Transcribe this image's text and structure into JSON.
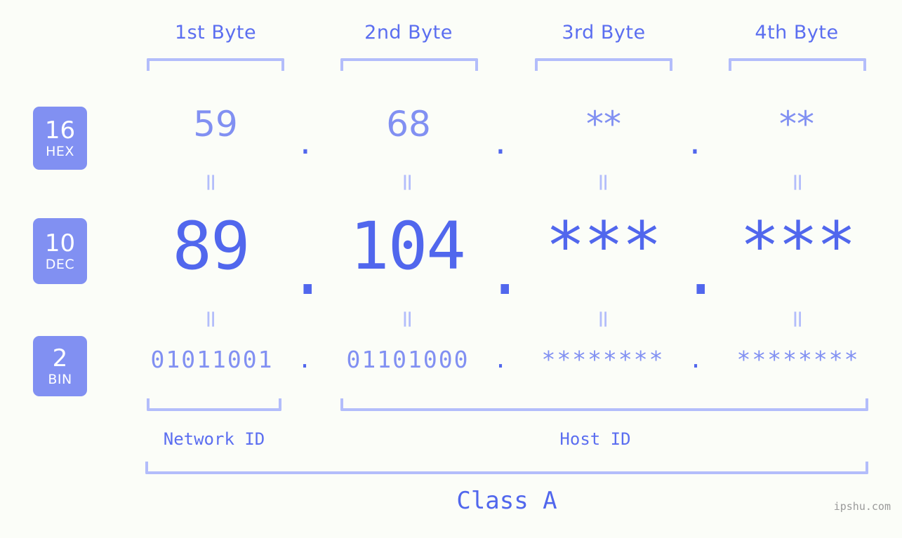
{
  "meta": {
    "background_color": "#fbfdf8",
    "accent_color": "#5167ed",
    "accent_light_color": "#8190f2",
    "accent_pale_color": "#b3bdfb",
    "watermark": "ipshu.com"
  },
  "byte_headers": [
    {
      "label": "1st Byte"
    },
    {
      "label": "2nd Byte"
    },
    {
      "label": "3rd Byte"
    },
    {
      "label": "4th Byte"
    }
  ],
  "bases": [
    {
      "number": "16",
      "name": "HEX"
    },
    {
      "number": "10",
      "name": "DEC"
    },
    {
      "number": "2",
      "name": "BIN"
    }
  ],
  "rows": {
    "hex": {
      "base_number": "16",
      "base_name": "HEX",
      "values": [
        "59",
        "68",
        "**",
        "**"
      ],
      "separator": "."
    },
    "dec": {
      "base_number": "10",
      "base_name": "DEC",
      "values": [
        "89",
        "104",
        "***",
        "***"
      ],
      "separator": "."
    },
    "bin": {
      "base_number": "2",
      "base_name": "BIN",
      "values": [
        "01011001",
        "01101000",
        "********",
        "********"
      ],
      "separator": "."
    }
  },
  "equals_marks": {
    "symbol": "=",
    "row1": [
      "=",
      "=",
      "=",
      "="
    ],
    "row2": [
      "=",
      "=",
      "=",
      "="
    ]
  },
  "segments": {
    "network_id": "Network ID",
    "host_id": "Host ID",
    "class": "Class A"
  }
}
